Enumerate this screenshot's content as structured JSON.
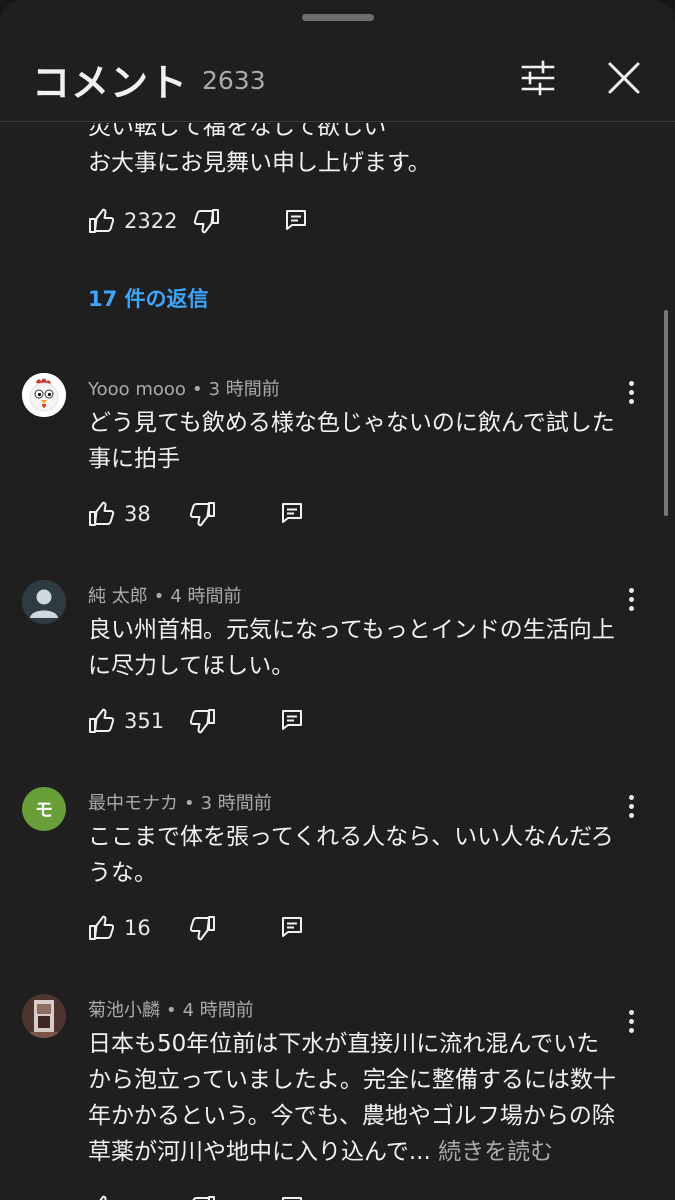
{
  "header": {
    "title": "コメント",
    "count": "2633"
  },
  "top_comment": {
    "text_partial": "災い転じて福をなして欲しい",
    "text_line2": "お大事にお見舞い申し上げます。",
    "likes": "2322",
    "replies_link": "17 件の返信"
  },
  "comments": [
    {
      "author": "Yooo mooo",
      "time": "3 時間前",
      "text": "どう見ても飲める様な色じゃないのに飲んで試した事に拍手",
      "likes": "38",
      "avatar_color": "#ffffff"
    },
    {
      "author": "純 太郎",
      "time": "4 時間前",
      "text": "良い州首相。元気になってもっとインドの生活向上に尽力してほしい。",
      "likes": "351",
      "avatar_color": "#cfd8dc"
    },
    {
      "author": "最中モナカ",
      "time": "3 時間前",
      "text": "ここまで体を張ってくれる人なら、いい人なんだろうな。",
      "likes": "16",
      "avatar_letter": "モ",
      "avatar_color": "#689f38"
    },
    {
      "author": "菊池小麟",
      "time": "4 時間前",
      "text": "日本も50年位前は下水が直接川に流れ混んでいたから泡立っていましたよ。完全に整備するには数十年かかるという。今でも、農地やゴルフ場からの除草薬が河川や地中に入り込んで...",
      "more_label": "続きを読む",
      "likes": "",
      "avatar_color": "#5d4037"
    }
  ],
  "separator": "•"
}
